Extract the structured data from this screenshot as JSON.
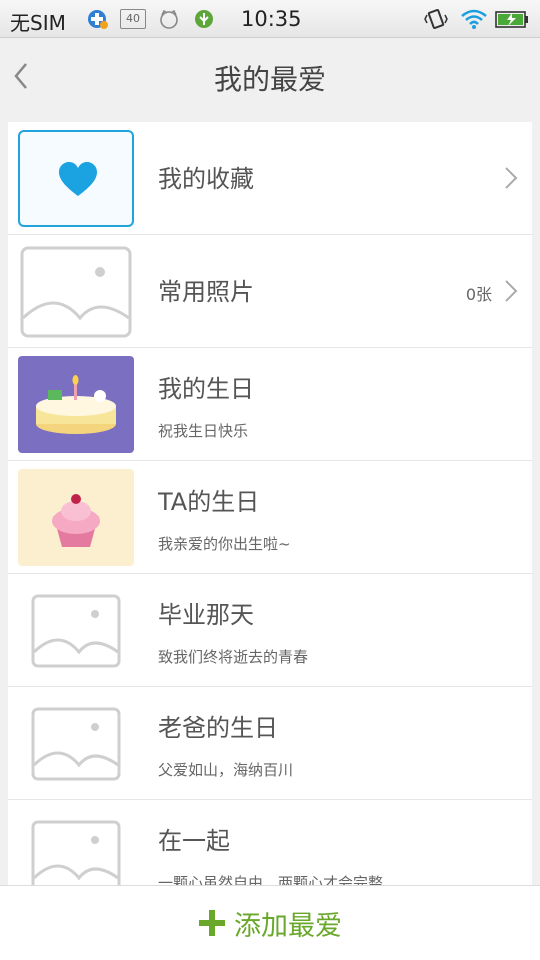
{
  "status_bar": {
    "carrier": "无SIM",
    "time": "10:35",
    "badge_text": "40"
  },
  "header": {
    "title": "我的最爱"
  },
  "list": {
    "items": [
      {
        "title": "我的收藏",
        "subtitle": "",
        "count": "",
        "thumb": "heart-icon"
      },
      {
        "title": "常用照片",
        "subtitle": "",
        "count": "0张",
        "thumb": "image-placeholder-icon"
      },
      {
        "title": "我的生日",
        "subtitle": "祝我生日快乐",
        "count": "",
        "thumb": "birthday-cake-image"
      },
      {
        "title": "TA的生日",
        "subtitle": "我亲爱的你出生啦~",
        "count": "",
        "thumb": "cupcake-image"
      },
      {
        "title": "毕业那天",
        "subtitle": "致我们终将逝去的青春",
        "count": "",
        "thumb": "image-placeholder-icon"
      },
      {
        "title": "老爸的生日",
        "subtitle": "父爱如山，海纳百川",
        "count": "",
        "thumb": "image-placeholder-icon"
      },
      {
        "title": "在一起",
        "subtitle": "一颗心虽然自由，两颗心才会完整",
        "count": "",
        "thumb": "image-placeholder-icon"
      }
    ]
  },
  "bottom": {
    "add_label": "添加最爱"
  },
  "colors": {
    "accent_green": "#6aa82c",
    "heart_blue": "#1aa3e0",
    "placeholder_gray": "#cfcfcf",
    "birthday_bg": "#7a6fc0",
    "cupcake_bg": "#fcefcf"
  }
}
